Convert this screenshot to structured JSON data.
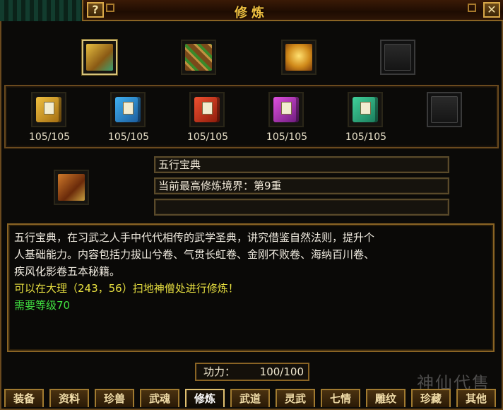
{
  "window": {
    "title": "修炼",
    "help_label": "?",
    "close_label": "✕"
  },
  "top_slots": [
    {
      "name": "golden-book-stack",
      "color": "#b78a2a",
      "accent": "#5ab07c",
      "selected": true
    },
    {
      "name": "scroll-bundle",
      "color": "#7a5a2a",
      "accent": "#5cae3a",
      "selected": false
    },
    {
      "name": "golden-chest",
      "color": "#c8861c",
      "accent": "#f0c040",
      "selected": false
    },
    {
      "name": "empty",
      "selected": false
    }
  ],
  "books": [
    {
      "name": "yellow-book",
      "color": "#d8a020",
      "count": "105/105"
    },
    {
      "name": "blue-book",
      "color": "#2a8ad0",
      "count": "105/105"
    },
    {
      "name": "red-book",
      "color": "#c82a1a",
      "count": "105/105"
    },
    {
      "name": "purple-book",
      "color": "#b02ab0",
      "count": "105/105"
    },
    {
      "name": "green-book",
      "color": "#2ab07a",
      "count": "105/105"
    },
    {
      "name": "empty"
    }
  ],
  "selected_item": {
    "name": "五行宝典",
    "realm": "当前最高修炼境界：第9重",
    "extra": ""
  },
  "description": {
    "lines": [
      "五行宝典，在习武之人手中代代相传的武学圣典，讲究借鉴自然法则，提升个",
      "人基础能力。内容包括力拔山兮卷、气贯长虹卷、金刚不败卷、海纳百川卷、",
      "疾风化影卷五本秘籍。"
    ],
    "location": "可以在大理（243，56）扫地神僧处进行修炼！",
    "requirement": "需要等级70"
  },
  "power": {
    "label": "功力：",
    "value": "100/100"
  },
  "tabs": [
    "装备",
    "资料",
    "珍兽",
    "武魂",
    "修炼",
    "武道",
    "灵武",
    "七情",
    "雕纹",
    "珍藏",
    "其他"
  ],
  "active_tab": "修炼",
  "watermark": "神仙代售"
}
